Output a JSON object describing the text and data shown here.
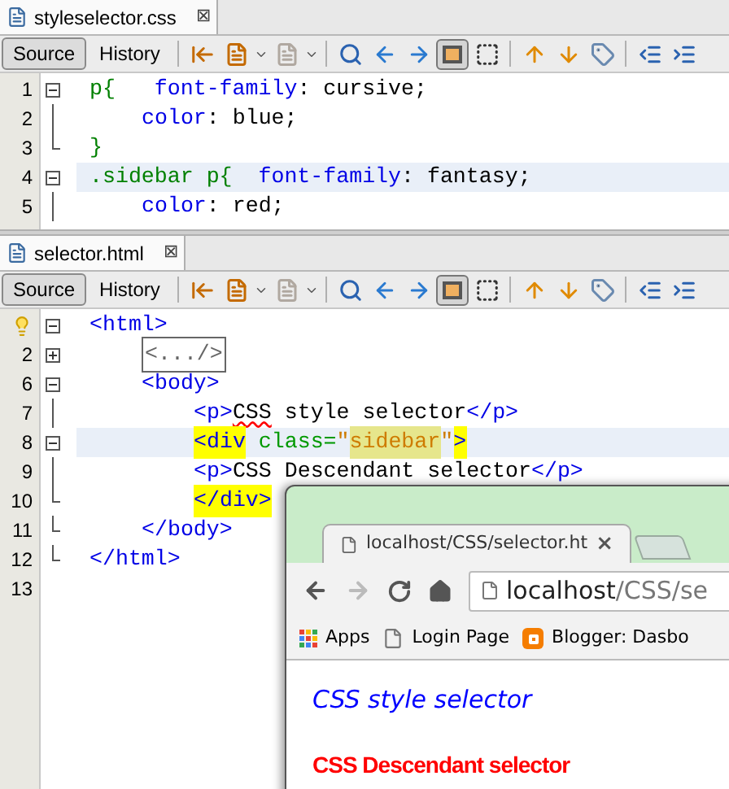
{
  "editors": [
    {
      "file_tab": {
        "label": "styleselector.css",
        "close": "⊠"
      },
      "views": [
        {
          "label": "Source",
          "selected": true
        },
        {
          "label": "History",
          "selected": false
        }
      ],
      "highlight_toggle_on": true,
      "lines": [
        {
          "number": "1",
          "kind": "fold_start",
          "current": false,
          "tokens": [
            {
              "kind": "selector",
              "text": "p{"
            },
            {
              "kind": "property",
              "text": "   font-family"
            },
            {
              "kind": "plain",
              "text": ": cursive;"
            }
          ],
          "children": [
            {
              "number": "2",
              "kind": "fold_body",
              "current": false,
              "tokens": [
                {
                  "kind": "property",
                  "text": "color"
                },
                {
                  "kind": "plain",
                  "text": ": blue;"
                }
              ]
            }
          ]
        },
        {
          "number": "3",
          "kind": "fold_end",
          "current": false,
          "tokens": [
            {
              "kind": "selector",
              "text": "}"
            }
          ]
        },
        {
          "number": "4",
          "kind": "fold_start",
          "current": true,
          "tokens": [
            {
              "kind": "selector",
              "text": ".sidebar p{"
            },
            {
              "kind": "property",
              "text": "  font-family"
            },
            {
              "kind": "plain",
              "text": ": fantasy;"
            }
          ],
          "children": [
            {
              "number": "5",
              "kind": "fold_body",
              "current": false,
              "tokens": [
                {
                  "kind": "property",
                  "text": "color"
                },
                {
                  "kind": "plain",
                  "text": ": red;"
                }
              ]
            }
          ]
        }
      ]
    },
    {
      "file_tab": {
        "label": "selector.html",
        "close": "⊠"
      },
      "views": [
        {
          "label": "Source",
          "selected": true
        },
        {
          "label": "History",
          "selected": false
        }
      ],
      "highlight_toggle_on": true,
      "lines": [
        {
          "hint": true,
          "kind": "fold_start",
          "current": false,
          "tokens": [
            {
              "kind": "tag",
              "text": "<html>"
            }
          ],
          "children": [
            {
              "number": "2",
              "kind": "folded",
              "current": false,
              "tokens": [
                {
                  "kind": "folded",
                  "text": "<.../>"
                }
              ]
            },
            {
              "number": "6",
              "kind": "fold_start",
              "current": false,
              "tokens": [
                {
                  "kind": "tag",
                  "text": "<body>"
                }
              ],
              "children": [
                {
                  "number": "7",
                  "kind": "fold_body",
                  "current": false,
                  "tokens": [
                    {
                      "kind": "tag",
                      "text": "<p>"
                    },
                    {
                      "kind": "misspelled",
                      "text": "CSS"
                    },
                    {
                      "kind": "plain",
                      "text": " style selector"
                    },
                    {
                      "kind": "tag",
                      "text": "</p>"
                    }
                  ]
                },
                {
                  "number": "8",
                  "kind": "fold_start",
                  "current": true,
                  "tokens": [
                    {
                      "kind": "tag_match",
                      "text": "<div"
                    },
                    {
                      "kind": "attribute",
                      "text": " class="
                    },
                    {
                      "kind": "string",
                      "text": "\""
                    },
                    {
                      "kind": "string_mark",
                      "text": "sidebar"
                    },
                    {
                      "kind": "string",
                      "text": "\""
                    },
                    {
                      "kind": "tag_match",
                      "text": ">"
                    }
                  ]
                },
                {
                  "number": "9",
                  "kind": "fold_body",
                  "current": false,
                  "tokens": [
                    {
                      "kind": "tag",
                      "text": "<p>"
                    },
                    {
                      "kind": "plain",
                      "text": "CSS Descendant selector"
                    },
                    {
                      "kind": "tag",
                      "text": "</p>"
                    }
                  ]
                },
                {
                  "number": "10",
                  "kind": "fold_end",
                  "current": false,
                  "tokens": [
                    {
                      "kind": "tag_match",
                      "text": "</div>"
                    }
                  ]
                }
              ]
            },
            {
              "number": "11",
              "kind": "fold_end",
              "current": false,
              "tokens": [
                {
                  "kind": "tag",
                  "text": "</body>"
                }
              ]
            }
          ]
        },
        {
          "number": "12",
          "kind": "fold_end",
          "current": false,
          "tokens": [
            {
              "kind": "tag",
              "text": "</html>"
            }
          ]
        },
        {
          "number": "13",
          "kind": "plain",
          "current": false
        }
      ]
    }
  ],
  "browser": {
    "tab": {
      "title": "localhost/CSS/selector.ht",
      "close": "×"
    },
    "address": {
      "host": "localhost",
      "path": "/CSS/se"
    },
    "bookmarks": [
      {
        "kind": "apps",
        "label": "Apps"
      },
      {
        "kind": "page",
        "label": "Login Page"
      },
      {
        "kind": "blogger",
        "label": "Blogger: Dasbo"
      }
    ],
    "content": [
      {
        "kind": "cursive",
        "text": "CSS style selector"
      },
      {
        "kind": "fantasy",
        "text": "CSS Descendant selector"
      }
    ]
  }
}
